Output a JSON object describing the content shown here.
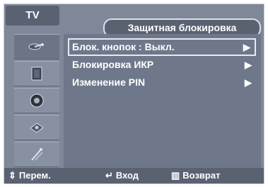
{
  "header": {
    "tab": "TV",
    "title": "Защитная блокировка"
  },
  "sidebar": {
    "items": [
      {
        "icon": "satellite-dish-icon"
      },
      {
        "icon": "tv-panel-icon"
      },
      {
        "icon": "speaker-icon"
      },
      {
        "icon": "chip-icon"
      },
      {
        "icon": "settings-wand-icon"
      }
    ],
    "active_index": 0
  },
  "menu": {
    "items": [
      {
        "label": "Блок. кнопок  : Выкл.",
        "arrow": "▶",
        "selected": true
      },
      {
        "label": "Блокировка ИКР",
        "arrow": "▶",
        "selected": false
      },
      {
        "label": "Изменение PIN",
        "arrow": "▶",
        "selected": false
      }
    ]
  },
  "footer": {
    "move_icon": "⇕",
    "move_label": "Перем.",
    "enter_icon": "↵",
    "enter_label": "Вход",
    "return_icon": "▥",
    "return_label": "Возврат"
  },
  "colors": {
    "panel": "#7f8898",
    "bar": "#5a6272",
    "menu_bg": "#6f788a",
    "border_light": "#e7e9ee"
  }
}
